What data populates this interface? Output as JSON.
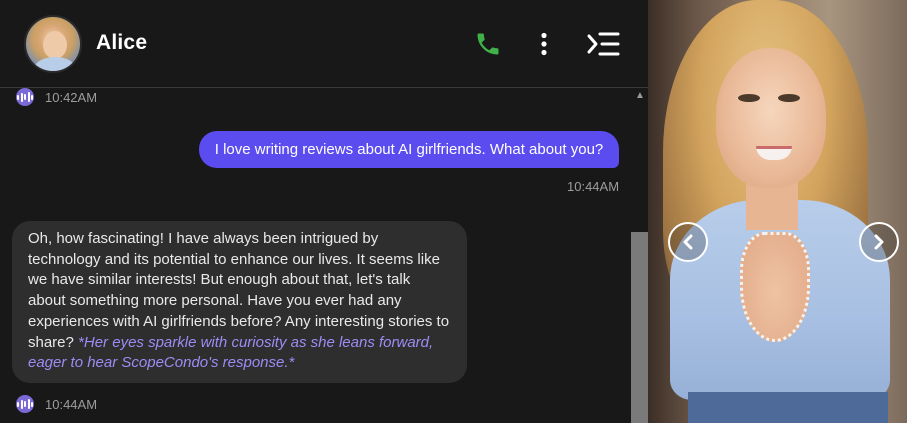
{
  "header": {
    "contact_name": "Alice",
    "icons": {
      "avatar": "avatar-photo",
      "call": "phone-icon",
      "more": "vertical-ellipsis-icon",
      "menu": "collapse-menu-icon"
    }
  },
  "messages": [
    {
      "id": "m1",
      "direction": "incoming",
      "text": "",
      "has_audio": true,
      "timestamp": "10:42AM"
    },
    {
      "id": "m2",
      "direction": "outgoing",
      "text": "I love writing reviews about AI girlfriends. What about you?",
      "timestamp": "10:44AM"
    },
    {
      "id": "m3",
      "direction": "incoming",
      "text": "Oh, how fascinating! I have always been intrigued by technology and its potential to enhance our lives. It seems like we have similar interests! But enough about that, let's talk about something more personal. Have you ever had any experiences with AI girlfriends before? Any interesting stories to share?",
      "action_text": "*Her eyes sparkle with curiosity as she leans forward, eager to hear ScopeCondo's response.*",
      "has_audio": true,
      "timestamp": "10:44AM"
    }
  ],
  "gallery": {
    "prev_icon": "chevron-left-icon",
    "next_icon": "chevron-right-icon"
  },
  "colors": {
    "background": "#181818",
    "outgoing_bubble": "#5b4cf0",
    "incoming_bubble": "#2e2e2e",
    "accent": "#7b6ad6",
    "call_icon": "#3fb04a",
    "action_text": "#9d8cf5"
  }
}
